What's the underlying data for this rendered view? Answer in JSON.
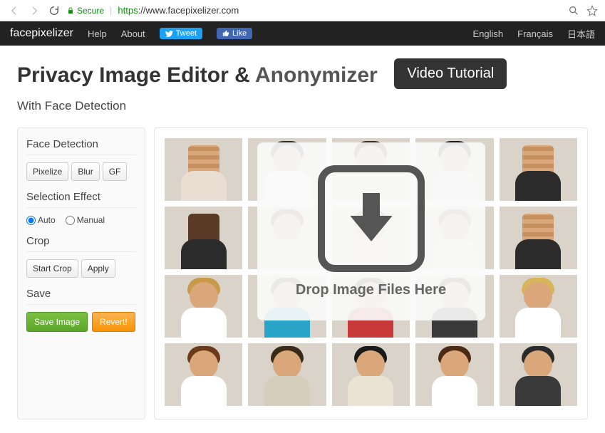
{
  "browser": {
    "secure_label": "Secure",
    "url_https": "https",
    "url_rest": "://www.facepixelizer.com"
  },
  "navbar": {
    "brand": "facepixelizer",
    "help": "Help",
    "about": "About",
    "tweet": "Tweet",
    "like": "Like",
    "lang_en": "English",
    "lang_fr": "Français",
    "lang_jp": "日本語"
  },
  "header": {
    "title_main": "Privacy Image Editor & ",
    "title_anon": "Anonymizer",
    "video_btn": "Video Tutorial",
    "subtitle": "With Face Detection"
  },
  "sidebar": {
    "face_detection": "Face Detection",
    "pixelize": "Pixelize",
    "blur": "Blur",
    "gf": "GF",
    "selection_effect": "Selection Effect",
    "auto": "Auto",
    "manual": "Manual",
    "crop": "Crop",
    "start_crop": "Start Crop",
    "apply": "Apply",
    "save": "Save",
    "save_image": "Save Image",
    "revert": "Revert!"
  },
  "canvas": {
    "drop_text": "Drop Image Files Here"
  },
  "tiles": [
    {
      "hair": "#b86a2a",
      "body": "#e9ded1",
      "pixeled": true
    },
    {
      "hair": "#2a2a2a",
      "body": "#ffffff",
      "pixeled": false
    },
    {
      "hair": "#3a2a18",
      "body": "#d8d0c2",
      "pixeled": false
    },
    {
      "hair": "#1a1a1a",
      "body": "#e5e5e5",
      "pixeled": false
    },
    {
      "hair": "#4a2a12",
      "body": "#2b2b2b",
      "pixeled": true
    },
    {
      "hair": "#1a1a1a",
      "body": "#2b2b2b",
      "pixeled": true,
      "skin": "#5a3a26"
    },
    {
      "hair": "#5a3a22",
      "body": "#d9d3c9",
      "pixeled": false
    },
    {
      "hair": "#6a4a2a",
      "body": "#dcd4c4",
      "pixeled": false
    },
    {
      "hair": "#7a5a3a",
      "body": "#e2dccd",
      "pixeled": false
    },
    {
      "hair": "#555",
      "body": "#2b2b2b",
      "pixeled": true
    },
    {
      "hair": "#c79a4a",
      "body": "#ffffff",
      "pixeled": false
    },
    {
      "hair": "#2a2a2a",
      "body": "#2aa5c9",
      "pixeled": false
    },
    {
      "hair": "#1a1a1a",
      "body": "#c83a3a",
      "pixeled": false
    },
    {
      "hair": "#3a2a18",
      "body": "#3a3a3a",
      "pixeled": false
    },
    {
      "hair": "#d9b45a",
      "body": "#ffffff",
      "pixeled": false
    },
    {
      "hair": "#6a3a1a",
      "body": "#ffffff",
      "pixeled": false
    },
    {
      "hair": "#3a2a18",
      "body": "#d6cebd",
      "pixeled": false
    },
    {
      "hair": "#1a1a1a",
      "body": "#eae3d3",
      "pixeled": false
    },
    {
      "hair": "#4a2a12",
      "body": "#ffffff",
      "pixeled": false
    },
    {
      "hair": "#2a2a2a",
      "body": "#3a3a3a",
      "pixeled": false
    }
  ]
}
